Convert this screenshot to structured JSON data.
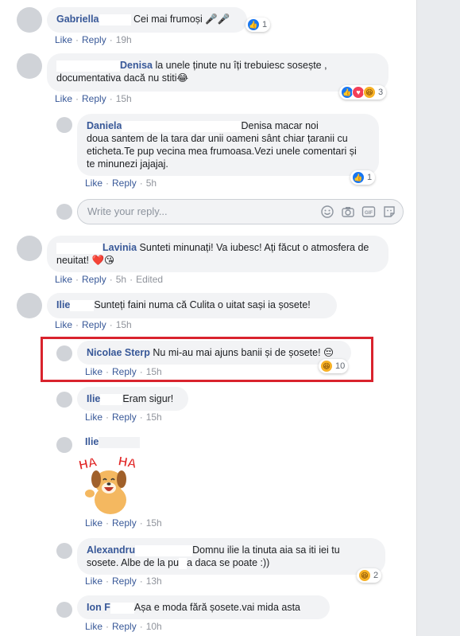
{
  "colors": {
    "link": "#385898",
    "meta": "#90949c",
    "bubble": "#f2f3f5",
    "highlight": "#d9232d",
    "like": "#1877f2",
    "love": "#f33e58",
    "haha": "#f7b125"
  },
  "comments": [
    {
      "name": "Gabriella",
      "text": "Cei mai frumoși 🎤🎤",
      "like": "Like",
      "reply": "Reply",
      "time": "19h",
      "reactions": "1"
    },
    {
      "name": "Denisa",
      "text_line1": " la unele ținute nu îți trebuiesc sosește ,",
      "text_line2": "documentativa dacă nu stiti😂",
      "like": "Like",
      "reply": "Reply",
      "time": "15h",
      "reactions": "3"
    },
    {
      "name": "Daniela",
      "mention": "Denisa",
      "text_line1": " macar noi",
      "text_line2": "doua santem de la tara dar unii oameni sânt chiar țaranii cu",
      "text_line3": "eticheta.Te pup vecina mea frumoasa.Vezi unele comentari și",
      "text_line4": "te minunezi jajajaj.",
      "like": "Like",
      "reply": "Reply",
      "time": "5h",
      "reactions": "1"
    },
    {
      "name": "Lavinia",
      "text_line1": " Sunteti minunați! Va iubesc! Ați făcut o atmosfera de",
      "text_line2": "neuitat! ❤️😘",
      "like": "Like",
      "reply": "Reply",
      "time": "5h",
      "edited": "Edited"
    },
    {
      "name": "Ilie",
      "text": "Sunteți faini numa că Culita o uitat sași ia șosete!",
      "like": "Like",
      "reply": "Reply",
      "time": "15h"
    },
    {
      "name": "Nicolae Sterp",
      "text": " Nu mi-au mai ajuns banii și de șosete! 😔",
      "like": "Like",
      "reply": "Reply",
      "time": "15h",
      "reactions": "10"
    },
    {
      "name": "Ilie",
      "text": "Eram sigur!",
      "like": "Like",
      "reply": "Reply",
      "time": "15h"
    },
    {
      "name": "Ilie",
      "sticker": "HA HA",
      "like": "Like",
      "reply": "Reply",
      "time": "15h"
    },
    {
      "name": "Alexandru",
      "text_line1": "Domnu ilie la tinuta aia sa iti iei tu",
      "text_line2": "sosete. Albe de la pu",
      "text_line2b": "a daca se poate :))",
      "like": "Like",
      "reply": "Reply",
      "time": "13h",
      "reactions": "2"
    },
    {
      "name": "Ion F",
      "text": "Așa e moda fără șosete.vai mida asta",
      "like": "Like",
      "reply": "Reply",
      "time": "10h"
    }
  ],
  "reply_box": {
    "placeholder": "Write your reply..."
  }
}
